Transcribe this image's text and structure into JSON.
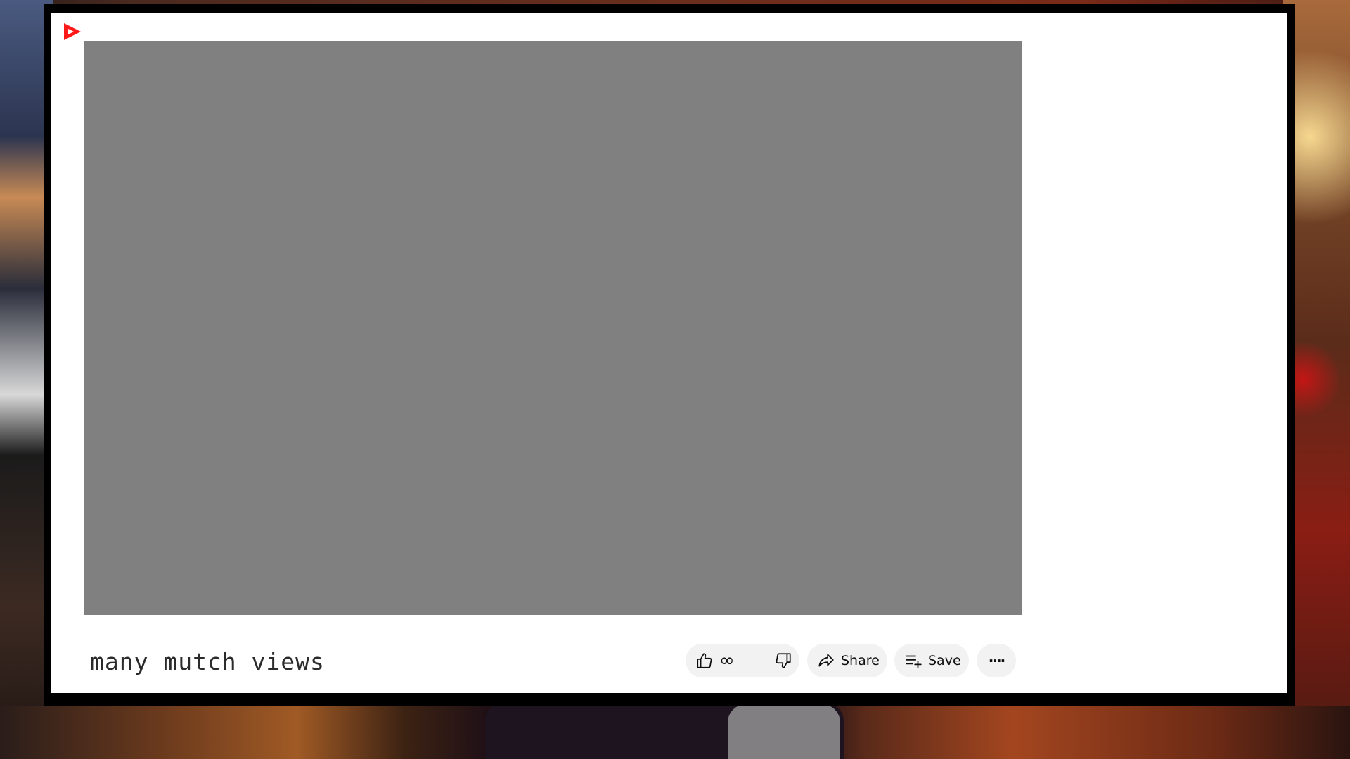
{
  "video": {
    "title": "many mutch views"
  },
  "actions": {
    "like_count": "∞",
    "share_label": "Share",
    "save_label": "Save",
    "more_label": "····"
  },
  "colors": {
    "brand": "#ff0000",
    "player_bg": "#808080",
    "pill_bg": "#f2f2f2"
  },
  "icons": [
    "logo-icon",
    "thumbs-up-icon",
    "thumbs-down-icon",
    "share-icon",
    "save-playlist-icon",
    "more-icon"
  ]
}
